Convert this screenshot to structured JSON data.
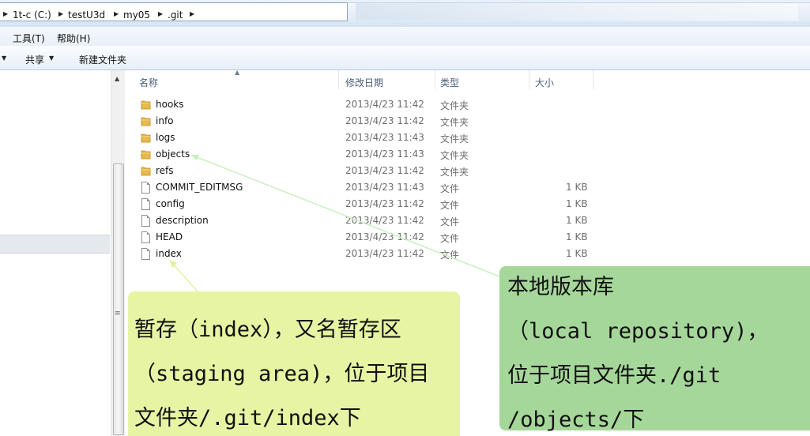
{
  "address_bar": {
    "crumbs": [
      "1t-c (C:)",
      "testU3d",
      "my05",
      ".git"
    ]
  },
  "menu_bar": {
    "items": [
      "工具(T)",
      "帮助(H)"
    ]
  },
  "toolbar": {
    "share_label": "共享",
    "new_folder_label": "新建文件夹"
  },
  "file_list": {
    "columns": {
      "name": "名称",
      "date": "修改日期",
      "type": "类型",
      "size": "大小"
    },
    "rows": [
      {
        "name": "hooks",
        "date": "2013/4/23 11:42",
        "type": "文件夹",
        "size": "",
        "kind": "folder"
      },
      {
        "name": "info",
        "date": "2013/4/23 11:42",
        "type": "文件夹",
        "size": "",
        "kind": "folder"
      },
      {
        "name": "logs",
        "date": "2013/4/23 11:43",
        "type": "文件夹",
        "size": "",
        "kind": "folder"
      },
      {
        "name": "objects",
        "date": "2013/4/23 11:43",
        "type": "文件夹",
        "size": "",
        "kind": "folder"
      },
      {
        "name": "refs",
        "date": "2013/4/23 11:42",
        "type": "文件夹",
        "size": "",
        "kind": "folder"
      },
      {
        "name": "COMMIT_EDITMSG",
        "date": "2013/4/23 11:43",
        "type": "文件",
        "size": "1 KB",
        "kind": "file"
      },
      {
        "name": "config",
        "date": "2013/4/23 11:42",
        "type": "文件",
        "size": "1 KB",
        "kind": "file"
      },
      {
        "name": "description",
        "date": "2013/4/23 11:42",
        "type": "文件",
        "size": "1 KB",
        "kind": "file"
      },
      {
        "name": "HEAD",
        "date": "2013/4/23 11:42",
        "type": "文件",
        "size": "1 KB",
        "kind": "file"
      },
      {
        "name": "index",
        "date": "2013/4/23 11:42",
        "type": "文件",
        "size": "1 KB",
        "kind": "file"
      }
    ]
  },
  "annotations": {
    "repository": {
      "lines": [
        "本地版本库",
        "（local repository)，",
        "位于项目文件夹./git",
        "/objects/下"
      ],
      "color": "#a6d79a"
    },
    "index": {
      "lines": [
        "暂存（index），又名暂存区",
        "（staging area)，位于项目",
        "文件夹/.git/index下"
      ],
      "color": "#e7f4a3"
    }
  },
  "colors": {
    "folder": "#e8b84a",
    "arrow": "#c8f0c0"
  }
}
